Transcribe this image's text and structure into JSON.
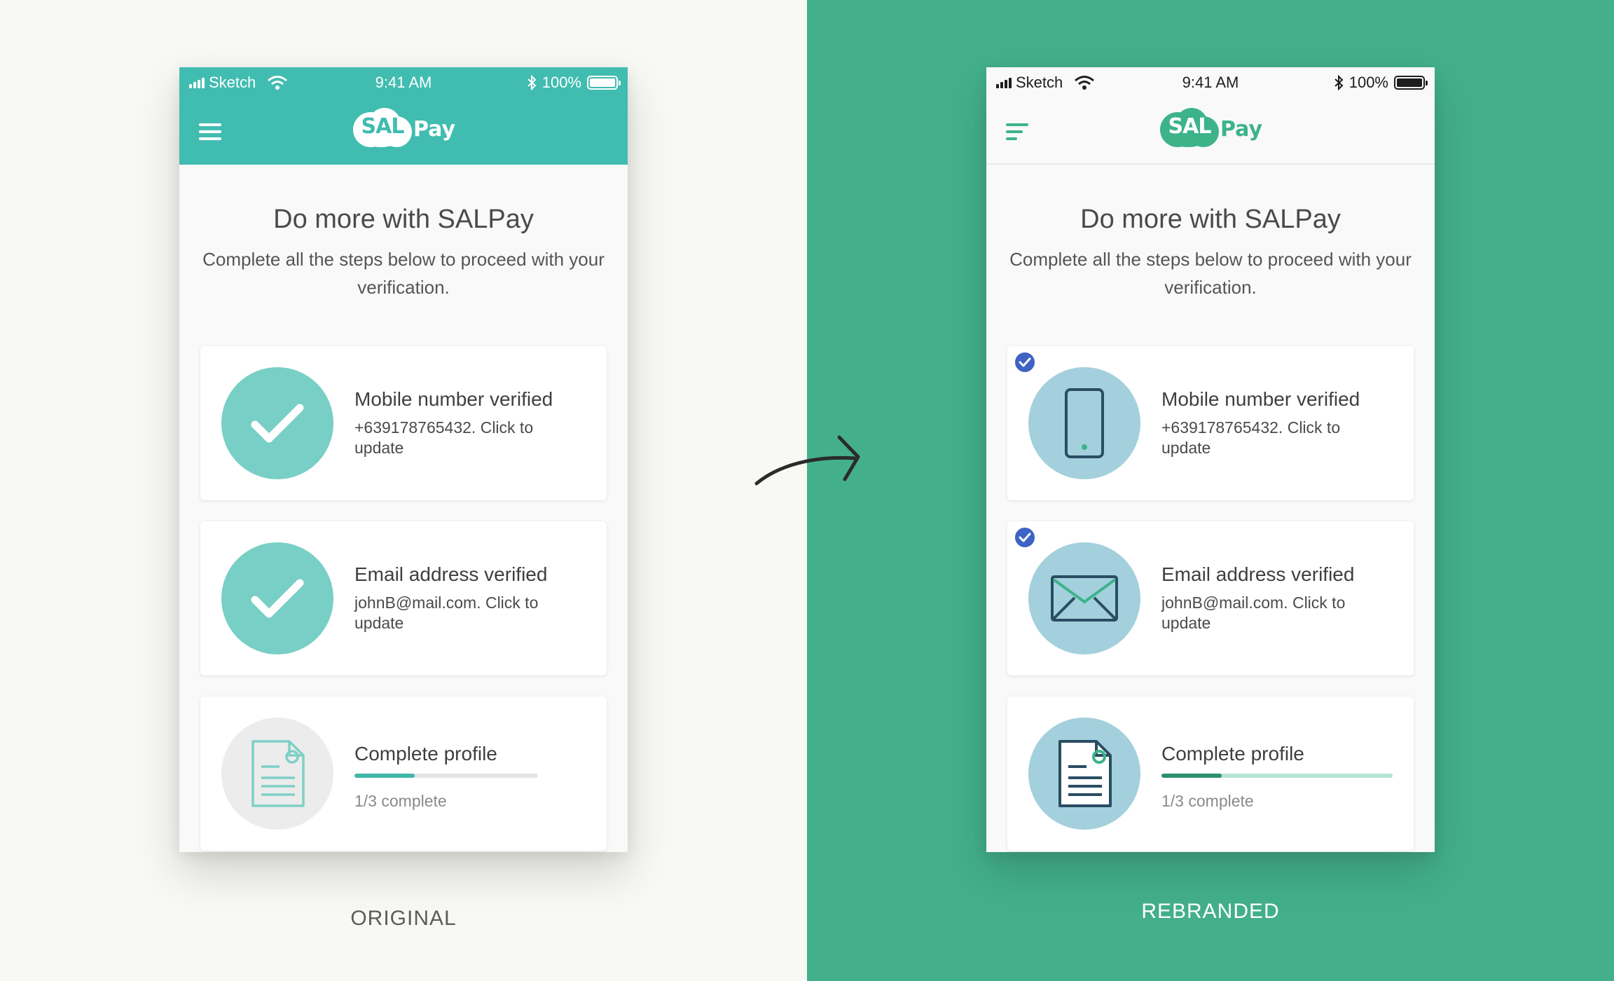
{
  "status_bar": {
    "carrier": "Sketch",
    "time": "9:41 AM",
    "battery": "100%"
  },
  "logo": {
    "mark": "SAL",
    "suffix": "Pay"
  },
  "main": {
    "title": "Do more with SALPay",
    "subtitle": "Complete all the steps below to proceed with your verification."
  },
  "original": {
    "caption": "ORIGINAL",
    "colors": {
      "header": "#41bcb0",
      "icon_circle": "#78cfc5",
      "profile_circle": "#ececec",
      "progress": "#3fb8ab"
    },
    "cards": [
      {
        "title": "Mobile number verified",
        "description": "+639178765432. Click to update",
        "icon": "checkmark-icon"
      },
      {
        "title": "Email address verified",
        "description": "johnB@mail.com. Click to update",
        "icon": "checkmark-icon"
      },
      {
        "title": "Complete profile",
        "progress_text": "1/3 complete",
        "progress": 0.33,
        "icon": "document-icon"
      }
    ]
  },
  "rebranded": {
    "caption": "REBRANDED",
    "colors": {
      "header": "#f9f9f9",
      "icon_circle": "#a3d0dc",
      "badge": "#3f63c4",
      "progress": "#2e8f6b",
      "progress_track": "#b6e4d3"
    },
    "cards": [
      {
        "title": "Mobile number verified",
        "description": "+639178765432. Click to update",
        "icon": "smartphone-icon"
      },
      {
        "title": "Email address verified",
        "description": "johnB@mail.com. Click to update",
        "icon": "envelope-icon"
      },
      {
        "title": "Complete profile",
        "progress_text": "1/3 complete",
        "progress": 0.26,
        "icon": "document-icon"
      }
    ]
  }
}
